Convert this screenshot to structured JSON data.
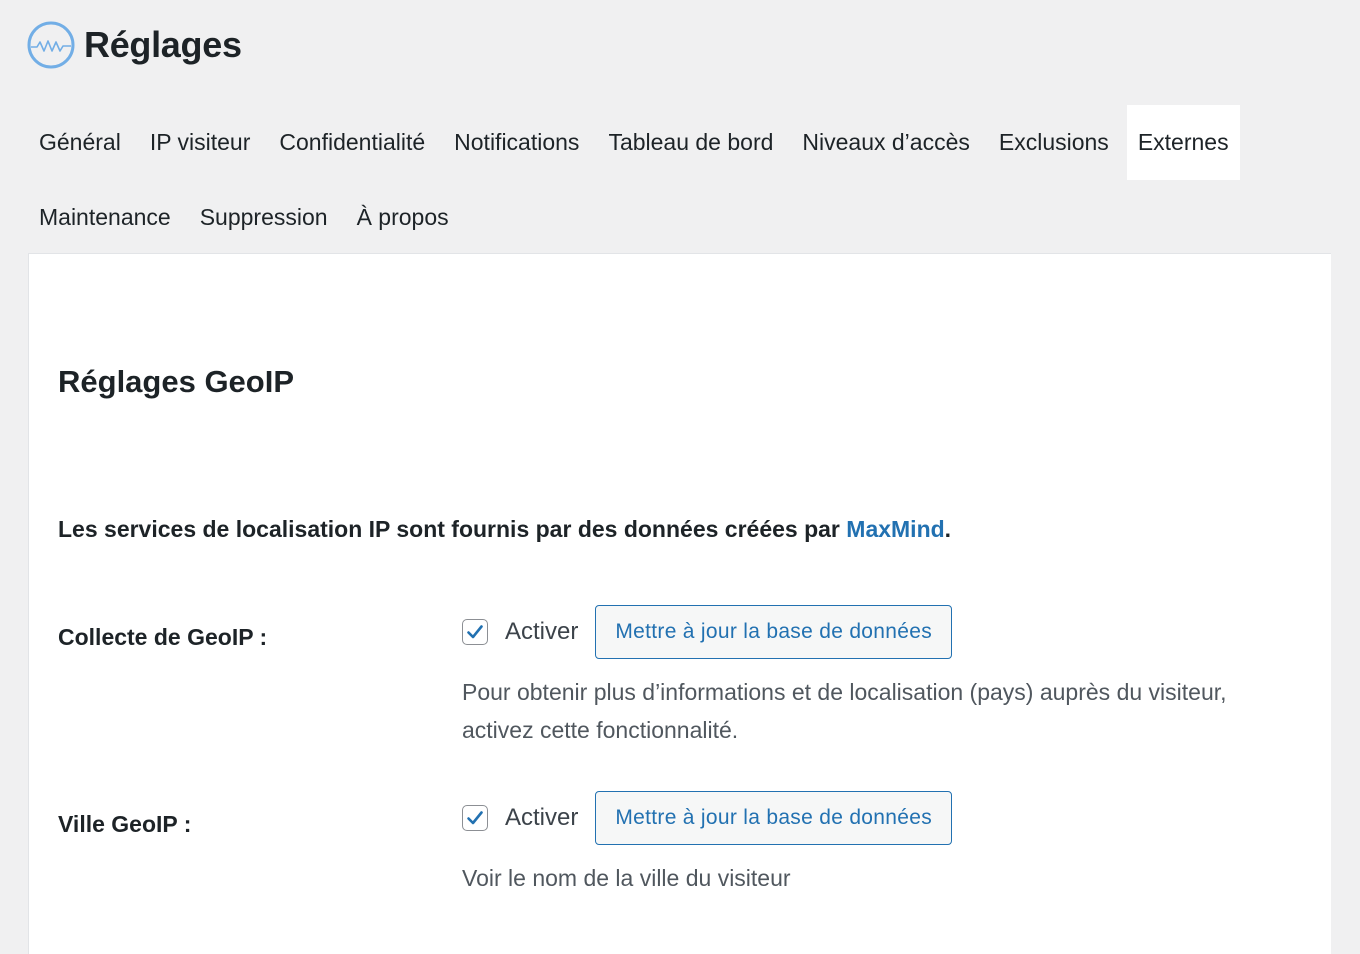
{
  "header": {
    "title": "Réglages",
    "logo_icon": "wave-logo-icon",
    "accent": "#72aee6"
  },
  "tabs": {
    "row1": [
      {
        "label": "Général",
        "active": false
      },
      {
        "label": "IP visiteur",
        "active": false
      },
      {
        "label": "Confidentialité",
        "active": false
      },
      {
        "label": "Notifications",
        "active": false
      },
      {
        "label": "Tableau de bord",
        "active": false
      },
      {
        "label": "Niveaux d’accès",
        "active": false
      },
      {
        "label": "Exclusions",
        "active": false
      },
      {
        "label": "Externes",
        "active": true
      }
    ],
    "row2": [
      {
        "label": "Maintenance",
        "active": false
      },
      {
        "label": "Suppression",
        "active": false
      },
      {
        "label": "À propos",
        "active": false
      }
    ]
  },
  "panel": {
    "section_title": "Réglages GeoIP",
    "intro_text": "Les services de localisation IP sont fournis par des données créées par ",
    "intro_link": "MaxMind",
    "intro_end": ".",
    "link_color": "#2271b1",
    "rows": [
      {
        "label": "Collecte de GeoIP :",
        "checked": true,
        "checkbox_label": "Activer",
        "button_label": "Mettre à jour la base de données",
        "description": "Pour obtenir plus d’informations et de localisation (pays) auprès du visiteur, activez cette fonctionnalité."
      },
      {
        "label": "Ville GeoIP :",
        "checked": true,
        "checkbox_label": "Activer",
        "button_label": "Mettre à jour la base de données",
        "description": "Voir le nom de la ville du visiteur"
      }
    ]
  }
}
